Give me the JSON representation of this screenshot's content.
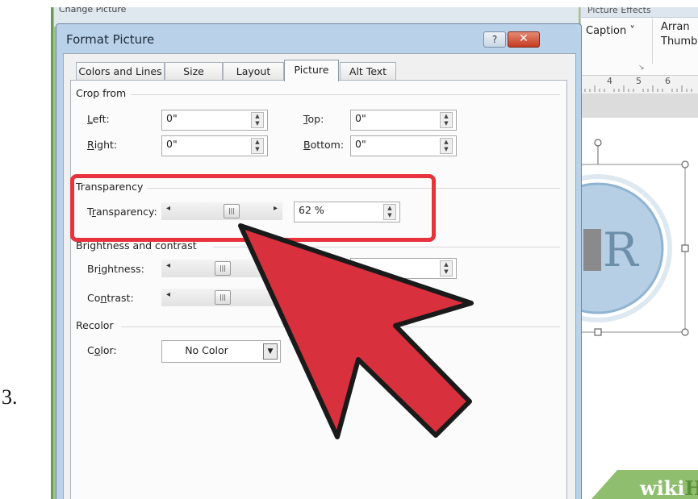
{
  "step_label": "3.",
  "background_window": {
    "title": "Change Picture",
    "ribbon_top_label": "Picture Effects",
    "caption_button": "Caption ˅",
    "arrange_label": "Arran",
    "thumbnail_label": "Thumb",
    "launcher_glyph": "↘",
    "ruler_numbers": [
      "4",
      "5",
      "6"
    ]
  },
  "dialog": {
    "title": "Format Picture",
    "help_glyph": "?",
    "close_glyph": "✕",
    "tabs": [
      {
        "label": "Colors and Lines",
        "active": false
      },
      {
        "label": "Size",
        "active": false
      },
      {
        "label": "Layout",
        "active": false
      },
      {
        "label": "Picture",
        "active": true
      },
      {
        "label": "Alt Text",
        "active": false
      }
    ],
    "crop_from": {
      "title": "Crop from",
      "left": {
        "label_u": "L",
        "label_rest": "eft:",
        "value": "0\""
      },
      "right": {
        "label_u": "R",
        "label_rest": "ight:",
        "value": "0\""
      },
      "top": {
        "label_u": "T",
        "label_rest": "op:",
        "value": "0\""
      },
      "bottom": {
        "label_u": "B",
        "label_rest": "ottom:",
        "value": "0\""
      }
    },
    "transparency": {
      "title": "Transparency",
      "label_pre": "T",
      "label_u": "r",
      "label_rest": "ansparency:",
      "value": "62 %",
      "level": 0.62
    },
    "brightness_contrast": {
      "title": "Brightness and contrast",
      "brightness": {
        "label_pre": "Br",
        "label_u": "i",
        "label_rest": "ghtness:"
      },
      "contrast": {
        "label_pre": "Co",
        "label_u": "n",
        "label_rest": "trast:"
      }
    },
    "recolor": {
      "title": "Recolor",
      "color_label_pre": "C",
      "color_label_u": "o",
      "color_label_rest": "lor:",
      "color_value": "No Color"
    }
  },
  "document_preview": {
    "letter": "R"
  },
  "watermark": {
    "wiki": "wiki",
    "how": "How"
  },
  "colors": {
    "highlight": "#e8333d",
    "arrow": "#d8303c",
    "frame": "#9cc97f",
    "dialog_border": "#b9d2ea"
  }
}
